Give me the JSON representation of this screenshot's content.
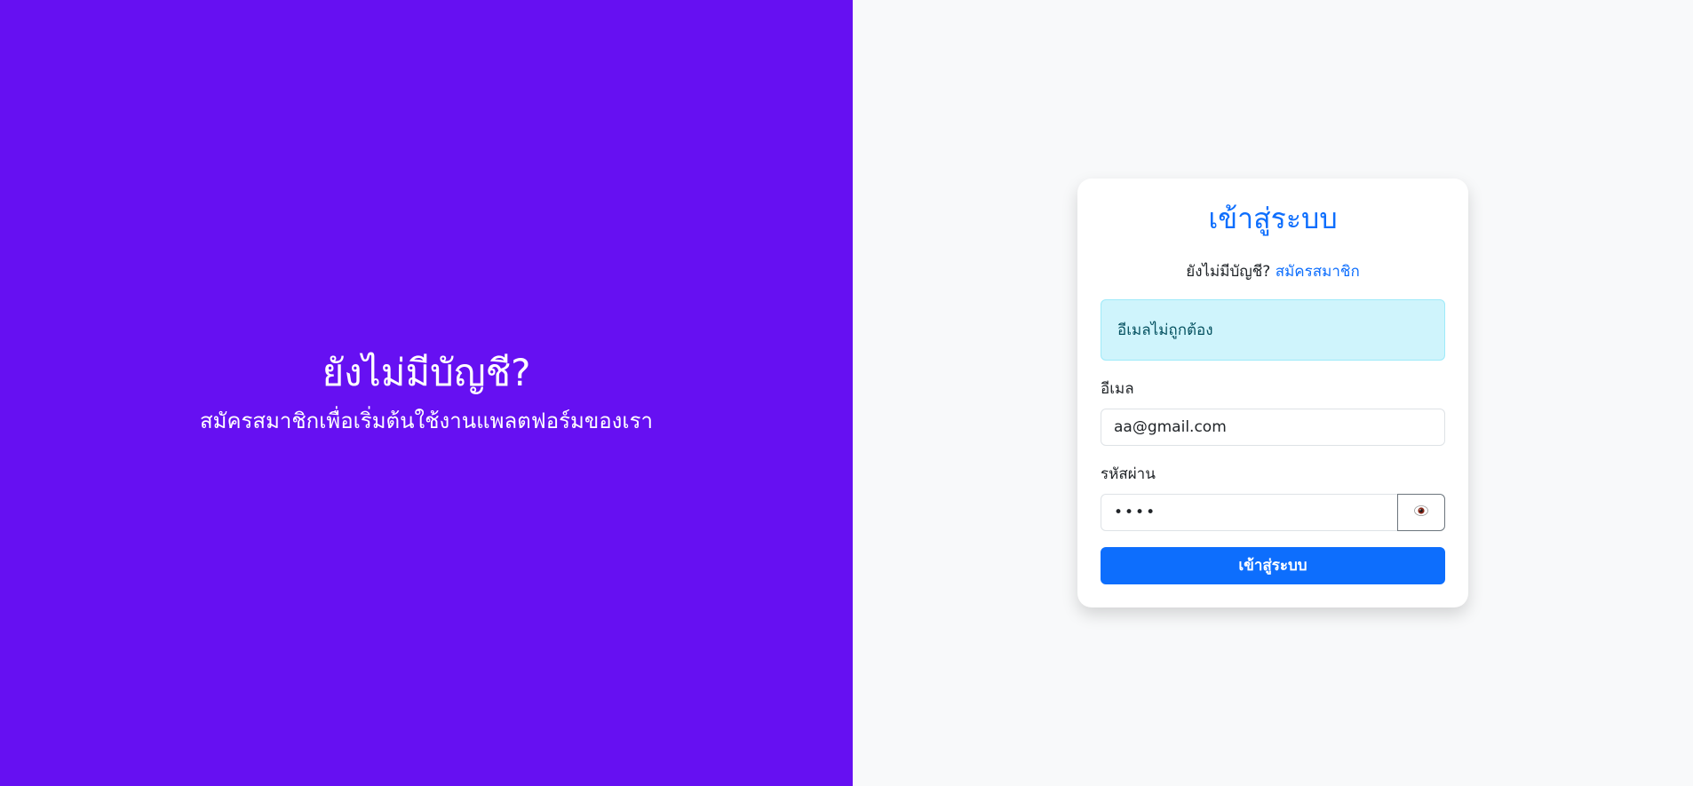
{
  "left": {
    "heading": "ยังไม่มีบัญชี?",
    "subtitle": "สมัครสมาชิกเพื่อเริ่มต้นใช้งานแพลตฟอร์มของเรา",
    "background_color": "#6610f2"
  },
  "login": {
    "title": "เข้าสู่ระบบ",
    "no_account_text": "ยังไม่มีบัญชี?",
    "signup_link": "สมัครสมาชิก",
    "alert": "อีเมลไม่ถูกต้อง",
    "email_label": "อีเมล",
    "email_value": "aa@gmail.com",
    "password_label": "รหัสผ่าน",
    "password_value": "••••",
    "toggle_icon": "eye-icon",
    "submit_label": "เข้าสู่ระบบ",
    "accent_color": "#0d6efd"
  }
}
